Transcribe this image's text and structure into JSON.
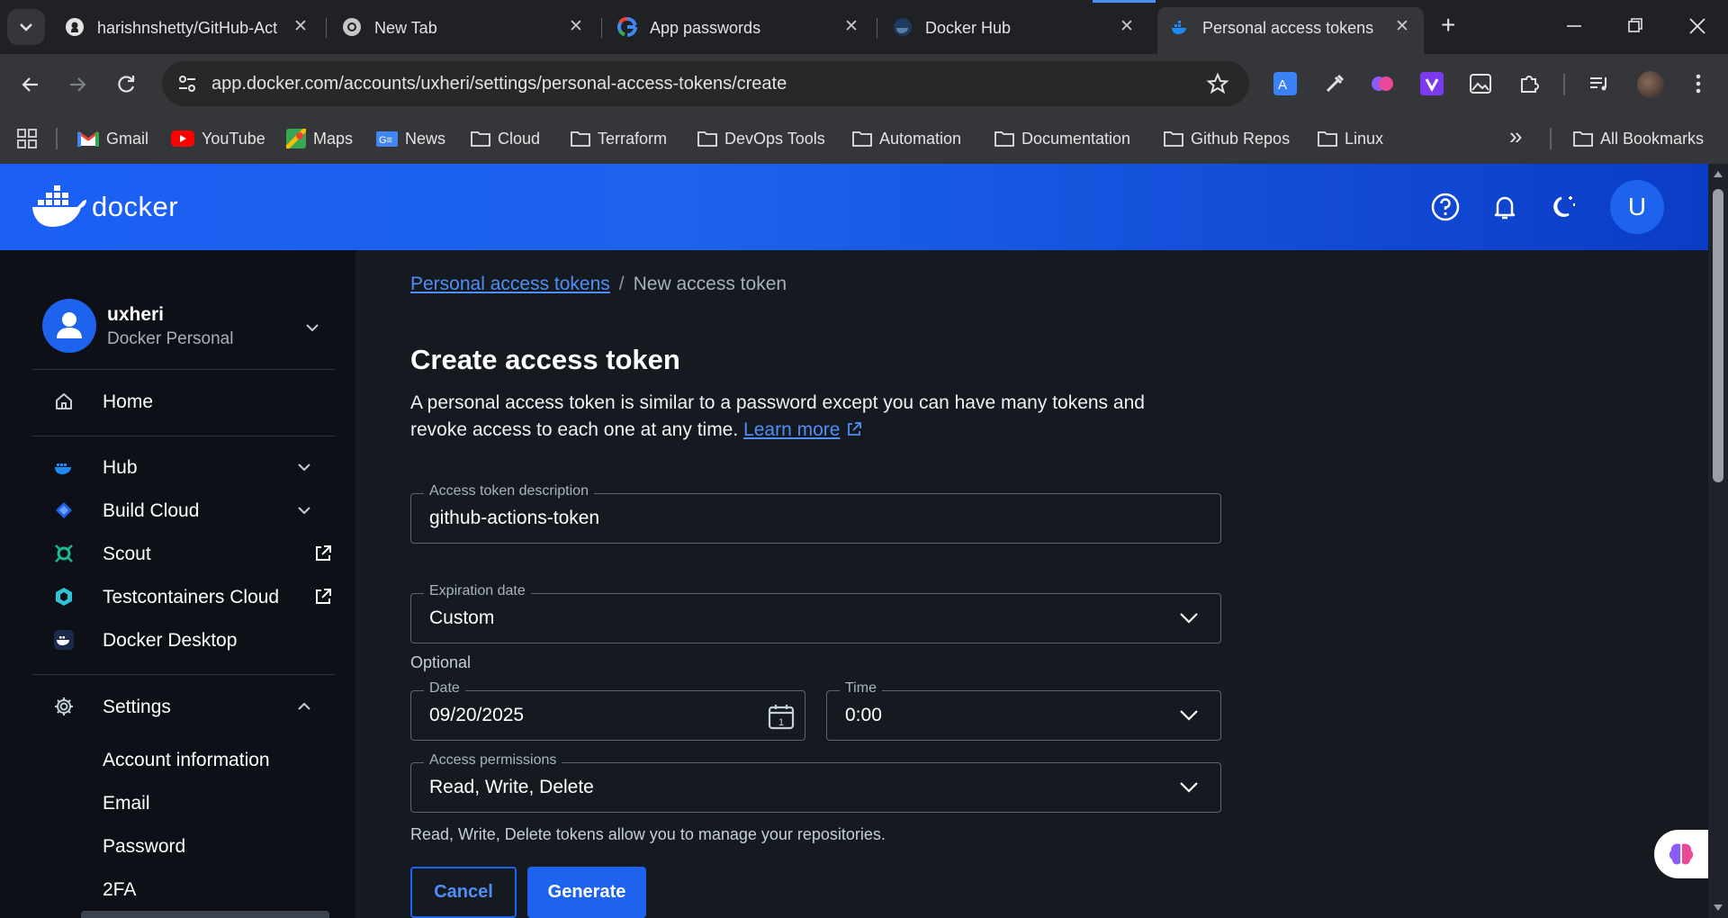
{
  "browser": {
    "tabs": [
      {
        "title": "harishnshetty/GitHub-Act",
        "favicon": "github-icon"
      },
      {
        "title": "New Tab",
        "favicon": "chrome-icon"
      },
      {
        "title": "App passwords",
        "favicon": "google-icon"
      },
      {
        "title": "Docker Hub",
        "favicon": "docker-icon"
      },
      {
        "title": "Personal access tokens | D",
        "favicon": "docker-icon",
        "active": true
      }
    ],
    "new_tab_label": "+",
    "url": "app.docker.com/accounts/uxheri/settings/personal-access-tokens/create",
    "bookmarks": [
      {
        "label": "Gmail",
        "icon": "gmail-icon"
      },
      {
        "label": "YouTube",
        "icon": "youtube-icon"
      },
      {
        "label": "Maps",
        "icon": "maps-icon"
      },
      {
        "label": "News",
        "icon": "news-icon"
      },
      {
        "label": "Cloud",
        "icon": "folder-icon"
      },
      {
        "label": "Terraform",
        "icon": "folder-icon"
      },
      {
        "label": "DevOps Tools",
        "icon": "folder-icon"
      },
      {
        "label": "Automation",
        "icon": "folder-icon"
      },
      {
        "label": "Documentation",
        "icon": "folder-icon"
      },
      {
        "label": "Github Repos",
        "icon": "folder-icon"
      },
      {
        "label": "Linux",
        "icon": "folder-icon"
      }
    ],
    "overflow_label": "»",
    "all_bookmarks_label": "All Bookmarks"
  },
  "header": {
    "brand": "docker",
    "avatar_letter": "U"
  },
  "sidebar": {
    "account": {
      "name": "uxheri",
      "plan": "Docker Personal"
    },
    "home": "Home",
    "items": [
      {
        "label": "Hub"
      },
      {
        "label": "Build Cloud"
      },
      {
        "label": "Scout"
      },
      {
        "label": "Testcontainers Cloud"
      },
      {
        "label": "Docker Desktop"
      }
    ],
    "settings": {
      "label": "Settings",
      "children": [
        "Account information",
        "Email",
        "Password",
        "2FA"
      ]
    }
  },
  "main": {
    "breadcrumb": {
      "parent": "Personal access tokens",
      "separator": "/",
      "current": "New access token"
    },
    "title": "Create access token",
    "intro": "A personal access token is similar to a password except you can have many tokens and revoke access to each one at any time.",
    "learn_more": "Learn more",
    "form": {
      "description": {
        "label": "Access token description",
        "value": "github-actions-token"
      },
      "expiration": {
        "label": "Expiration date",
        "value": "Custom"
      },
      "optional_label": "Optional",
      "date": {
        "label": "Date",
        "value": "09/20/2025"
      },
      "time": {
        "label": "Time",
        "value": "0:00"
      },
      "permissions": {
        "label": "Access permissions",
        "value": "Read, Write, Delete"
      },
      "helper": "Read, Write, Delete tokens allow you to manage your repositories."
    },
    "buttons": {
      "cancel": "Cancel",
      "generate": "Generate"
    }
  },
  "colors": {
    "accent": "#1d63ed",
    "link": "#4f8ef7",
    "page_bg": "#151a21",
    "sidebar_bg": "#0d1117"
  }
}
